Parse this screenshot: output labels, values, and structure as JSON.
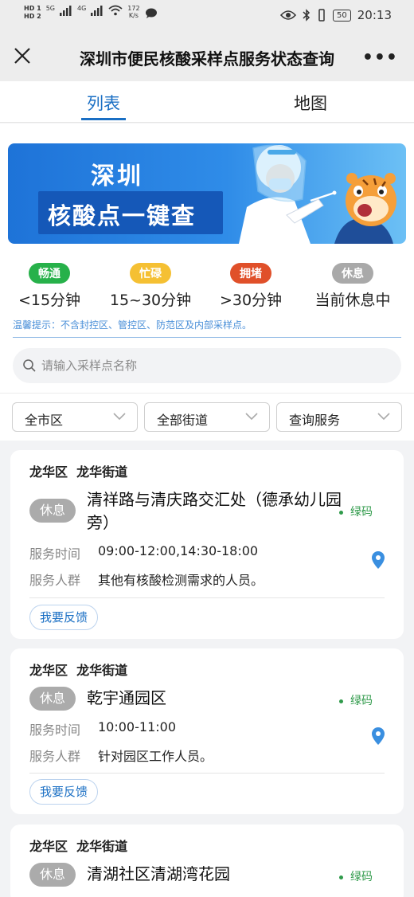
{
  "status_bar": {
    "signal1": "HD 1",
    "signal2": "HD 2",
    "net5g": "5G",
    "net4g": "4G",
    "speed": "172",
    "speed_unit": "K/s",
    "battery": "50",
    "time": "20:13"
  },
  "header": {
    "title": "深圳市便民核酸采样点服务状态查询",
    "more": "•••"
  },
  "tabs": [
    {
      "label": "列表",
      "active": true
    },
    {
      "label": "地图",
      "active": false
    }
  ],
  "banner": {
    "line1": "深圳",
    "line2": "核酸点一键查"
  },
  "legend": [
    {
      "badge": "畅通",
      "value": "<15分钟",
      "color": "#27b14a"
    },
    {
      "badge": "忙碌",
      "value": "15~30分钟",
      "color": "#f5c033"
    },
    {
      "badge": "拥堵",
      "value": ">30分钟",
      "color": "#e0502a"
    },
    {
      "badge": "休息",
      "value": "当前休息中",
      "color": "#a9a9a9"
    }
  ],
  "tip": "温馨提示：不含封控区、管控区、防范区及内部采样点。",
  "search": {
    "placeholder": "请输入采样点名称"
  },
  "filters": [
    {
      "label": "全市区"
    },
    {
      "label": "全部街道"
    },
    {
      "label": "查询服务"
    }
  ],
  "cards": [
    {
      "district": "龙华区",
      "street": "龙华街道",
      "status": "休息",
      "name": "清祥路与清庆路交汇处（德承幼儿园旁）",
      "code": "绿码",
      "time_label": "服务时间",
      "time": "09:00-12:00,14:30-18:00",
      "crowd_label": "服务人群",
      "crowd": "其他有核酸检测需求的人员。",
      "feedback": "我要反馈"
    },
    {
      "district": "龙华区",
      "street": "龙华街道",
      "status": "休息",
      "name": "乾宇通园区",
      "code": "绿码",
      "time_label": "服务时间",
      "time": "10:00-11:00",
      "crowd_label": "服务人群",
      "crowd": "针对园区工作人员。",
      "feedback": "我要反馈"
    },
    {
      "district": "龙华区",
      "street": "龙华街道",
      "status": "休息",
      "name": "清湖社区清湖湾花园",
      "code": "绿码"
    }
  ],
  "colors": {
    "accent": "#1a6fc4",
    "green_code": "#2f9a4a",
    "rest_badge": "#ababab"
  }
}
